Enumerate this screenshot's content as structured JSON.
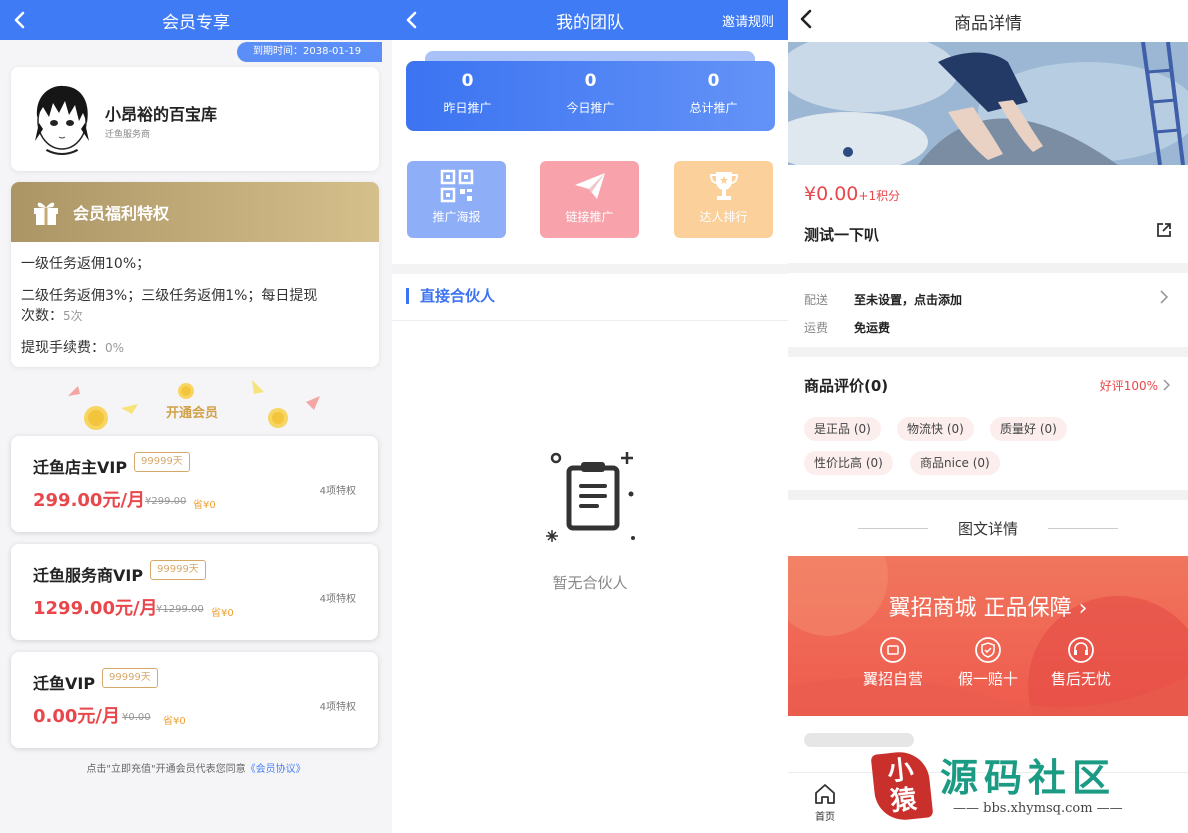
{
  "membership": {
    "title": "会员专享",
    "profile": {
      "name": "小昂裕的百宝库",
      "role": "迁鱼服务商",
      "expire": "到期时间：2038-01-19"
    },
    "benefits": {
      "title": "会员福利特权",
      "line1": "一级任务返佣10%；",
      "line2a": "二级任务返佣3%；三级任务返佣1%；每日提现",
      "line2b": "次数：",
      "line2b_value": "5次",
      "line3": "提现手续费：",
      "line3_value": "0%"
    },
    "open_title": "开通会员",
    "plans": [
      {
        "name": "迁鱼店主VIP",
        "days": "99999天",
        "price": "299.00元/月",
        "old": "¥299.00",
        "save": "省¥0",
        "privileges": "4项特权"
      },
      {
        "name": "迁鱼服务商VIP",
        "days": "99999天",
        "price": "1299.00元/月",
        "old": "¥1299.00",
        "save": "省¥0",
        "privileges": "4项特权"
      },
      {
        "name": "迁鱼VIP",
        "days": "99999天",
        "price": "0.00元/月",
        "old": "¥0.00",
        "save": "省¥0",
        "privileges": "4项特权"
      }
    ],
    "agreement_prefix": "点击\"立即充值\"开通会员代表您同意",
    "agreement_link": "《会员协议》"
  },
  "team": {
    "title": "我的团队",
    "right_action": "邀请规则",
    "stats": [
      {
        "value": "0",
        "label": "昨日推广"
      },
      {
        "value": "0",
        "label": "今日推广"
      },
      {
        "value": "0",
        "label": "总计推广"
      }
    ],
    "actions": [
      {
        "label": "推广海报",
        "color": "#8eaef8",
        "icon": "qrcode-icon"
      },
      {
        "label": "链接推广",
        "color": "#f8a3ab",
        "icon": "paper-plane-icon"
      },
      {
        "label": "达人排行",
        "color": "#fcd09a",
        "icon": "trophy-icon"
      }
    ],
    "section_title": "直接合伙人",
    "empty_text": "暂无合伙人"
  },
  "product": {
    "title": "商品详情",
    "price": "¥0.00",
    "points": "+1积分",
    "name": "测试一下叭",
    "delivery_label": "配送",
    "delivery_value": "至未设置，点击添加",
    "freight_label": "运费",
    "freight_value": "免运费",
    "review_title": "商品评价(0)",
    "review_rate": "好评100%",
    "tags": [
      "是正品 (0)",
      "物流快 (0)",
      "质量好 (0)",
      "性价比高 (0)",
      "商品nice (0)"
    ],
    "details_title": "图文详情",
    "promo_title": "翼招商城 正品保障",
    "promo_items": [
      "翼招自营",
      "假一赔十",
      "售后无忧"
    ],
    "nav_home": "首页"
  },
  "watermark": {
    "seal": "小\n猿",
    "big": "源码社区",
    "url": "bbs.xhymsq.com"
  }
}
